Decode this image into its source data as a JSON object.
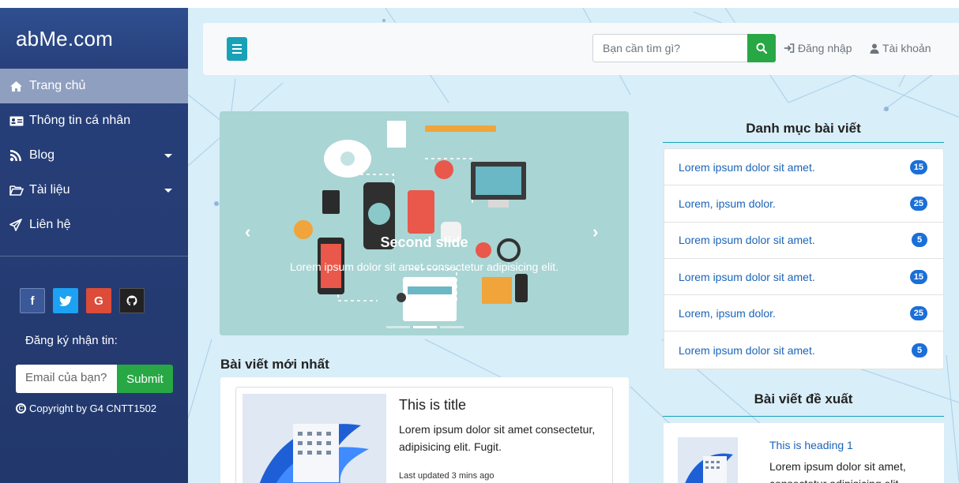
{
  "sidebar": {
    "brand": "abMe.com",
    "items": [
      {
        "label": "Trang chủ",
        "icon": "home-icon",
        "active": true
      },
      {
        "label": "Thông tin cá nhân",
        "icon": "id-card-icon"
      },
      {
        "label": "Blog",
        "icon": "blog-icon",
        "dropdown": true
      },
      {
        "label": "Tài liệu",
        "icon": "folder-open-icon",
        "dropdown": true
      },
      {
        "label": "Liên hệ",
        "icon": "paper-plane-icon"
      }
    ],
    "socials": [
      {
        "label": "f",
        "icon": "facebook-icon"
      },
      {
        "label": "t",
        "icon": "twitter-icon"
      },
      {
        "label": "G",
        "icon": "google-icon"
      },
      {
        "label": "gh",
        "icon": "github-icon"
      }
    ],
    "subscribe_label": "Đăng ký nhận tin:",
    "email_placeholder": "Email của bạn?",
    "submit_label": "Submit",
    "copyright": "Copyright by G4 CNTT1502"
  },
  "topbar": {
    "search_placeholder": "Bạn cần tìm gì?",
    "login_label": "Đăng nhập",
    "account_label": "Tài khoản"
  },
  "carousel": {
    "title": "Second slide",
    "text": "Lorem ipsum dolor sit amet consectetur adipisicing elit.",
    "prev": "‹",
    "next": "›",
    "slide_count": 3,
    "active_slide": 2
  },
  "latest": {
    "section_title": "Bài viết mới nhất",
    "post": {
      "title": "This is title",
      "excerpt": "Lorem ipsum dolor sit amet consectetur, adipisicing elit. Fugit.",
      "updated": "Last updated 3 mins ago"
    }
  },
  "categories": {
    "title": "Danh mục bài viết",
    "items": [
      {
        "label": "Lorem ipsum dolor sit amet.",
        "count": "15"
      },
      {
        "label": "Lorem, ipsum dolor.",
        "count": "25"
      },
      {
        "label": "Lorem ipsum dolor sit amet.",
        "count": "5"
      },
      {
        "label": "Lorem ipsum dolor sit amet.",
        "count": "15"
      },
      {
        "label": "Lorem, ipsum dolor.",
        "count": "25"
      },
      {
        "label": "Lorem ipsum dolor sit amet.",
        "count": "5"
      }
    ]
  },
  "suggested": {
    "title": "Bài viết đề xuất",
    "heading": "This is heading 1",
    "text": "Lorem ipsum dolor sit amet, consectetur adipisicing elit."
  },
  "colors": {
    "sidebar_bg": "#26427c",
    "active_item": "#8f9fbf",
    "accent_teal": "#17a2b8",
    "accent_green": "#28a745",
    "badge_blue": "#1a6fd8",
    "link_blue": "#1a64b8"
  }
}
